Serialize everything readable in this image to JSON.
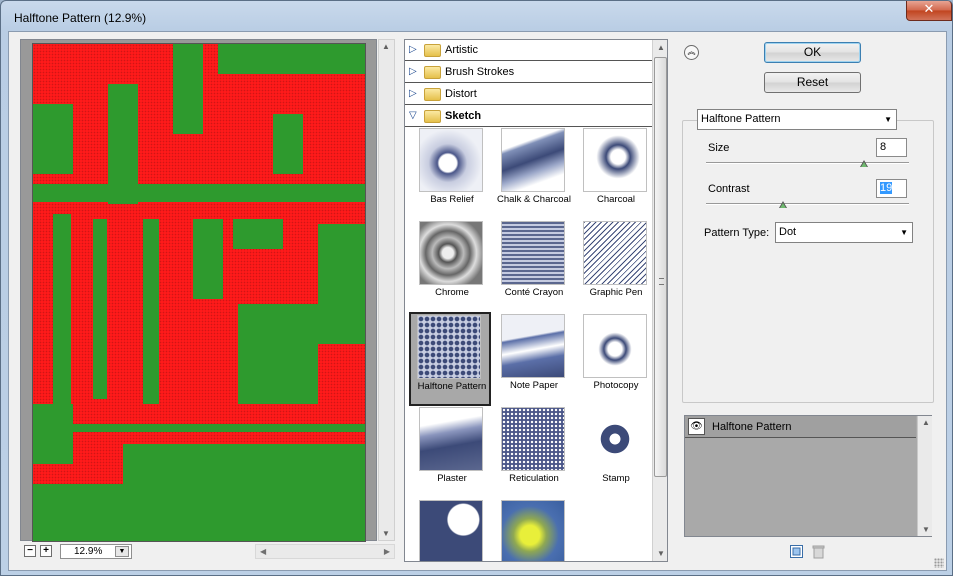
{
  "window": {
    "title": "Halftone Pattern (12.9%)"
  },
  "preview": {
    "zoom_value": "12.9%",
    "zoom_out_symbol": "−",
    "zoom_in_symbol": "+"
  },
  "gallery": {
    "categories": [
      {
        "label": "Artistic",
        "open": false
      },
      {
        "label": "Brush Strokes",
        "open": false
      },
      {
        "label": "Distort",
        "open": false
      },
      {
        "label": "Sketch",
        "open": true
      }
    ],
    "filters": [
      {
        "label": "Bas Relief"
      },
      {
        "label": "Chalk & Charcoal"
      },
      {
        "label": "Charcoal"
      },
      {
        "label": "Chrome"
      },
      {
        "label": "Conté Crayon"
      },
      {
        "label": "Graphic Pen"
      },
      {
        "label": "Halftone Pattern",
        "selected": true
      },
      {
        "label": "Note Paper"
      },
      {
        "label": "Photocopy"
      },
      {
        "label": "Plaster"
      },
      {
        "label": "Reticulation"
      },
      {
        "label": "Stamp"
      }
    ]
  },
  "buttons": {
    "ok": "OK",
    "reset": "Reset"
  },
  "settings": {
    "filter_select": "Halftone Pattern",
    "size_label": "Size",
    "size_value": "8",
    "size_fraction": 0.78,
    "contrast_label": "Contrast",
    "contrast_value": "19",
    "contrast_fraction": 0.38,
    "pattern_type_label": "Pattern Type:",
    "pattern_type_value": "Dot"
  },
  "layers": {
    "items": [
      {
        "label": "Halftone Pattern",
        "visible": true
      }
    ]
  },
  "colors": {
    "preview_red": "#ff1a1a",
    "preview_green": "#2e9a2e",
    "thumb_ink": "#3c4a78"
  }
}
